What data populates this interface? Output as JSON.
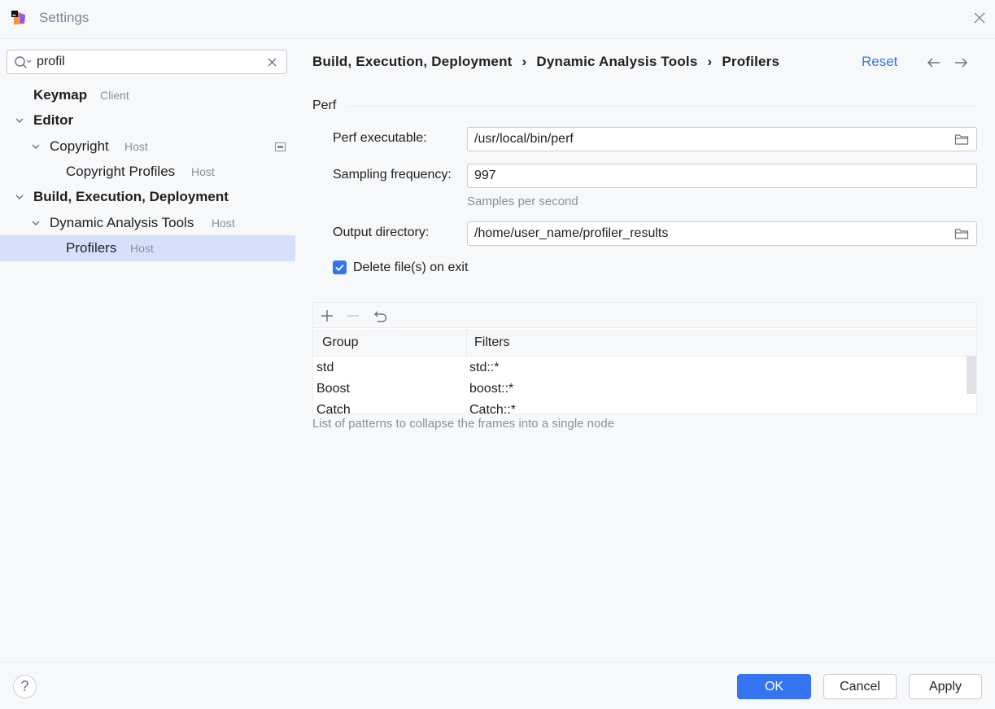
{
  "window": {
    "title": "Settings"
  },
  "search": {
    "value": "profil"
  },
  "tree": [
    {
      "label": "Keymap",
      "hint": "Client"
    },
    {
      "label": "Editor",
      "hint": ""
    },
    {
      "label": "Copyright",
      "hint": "Host"
    },
    {
      "label": "Copyright Profiles",
      "hint": "Host"
    },
    {
      "label": "Build, Execution, Deployment",
      "hint": ""
    },
    {
      "label": "Dynamic Analysis Tools",
      "hint": "Host"
    },
    {
      "label": "Profilers",
      "hint": "Host"
    }
  ],
  "breadcrumb": [
    "Build, Execution, Deployment",
    "Dynamic Analysis Tools",
    "Profilers"
  ],
  "breadcrumb_sep": "›",
  "header": {
    "reset_label": "Reset"
  },
  "perf": {
    "section_title": "Perf",
    "executable_label": "Perf executable:",
    "executable_value": "/usr/local/bin/perf",
    "sampling_label": "Sampling frequency:",
    "sampling_value": "997",
    "sampling_hint": "Samples per second",
    "output_label": "Output directory:",
    "output_value": "/home/user_name/profiler_results",
    "delete_label": "Delete file(s) on exit",
    "delete_checked": true
  },
  "table": {
    "columns": [
      "Group",
      "Filters"
    ],
    "rows": [
      [
        "std",
        "std::*"
      ],
      [
        "Boost",
        "boost::*"
      ],
      [
        "Catch",
        "Catch::*"
      ]
    ],
    "hint": "List of patterns to collapse the frames into a single node"
  },
  "footer": {
    "help_label": "?",
    "ok_label": "OK",
    "cancel_label": "Cancel",
    "apply_label": "Apply"
  },
  "colors": {
    "accent": "#3574f0",
    "selection": "#d5e1fb",
    "background": "#f7f8fa",
    "hint": "#8c8f99"
  }
}
